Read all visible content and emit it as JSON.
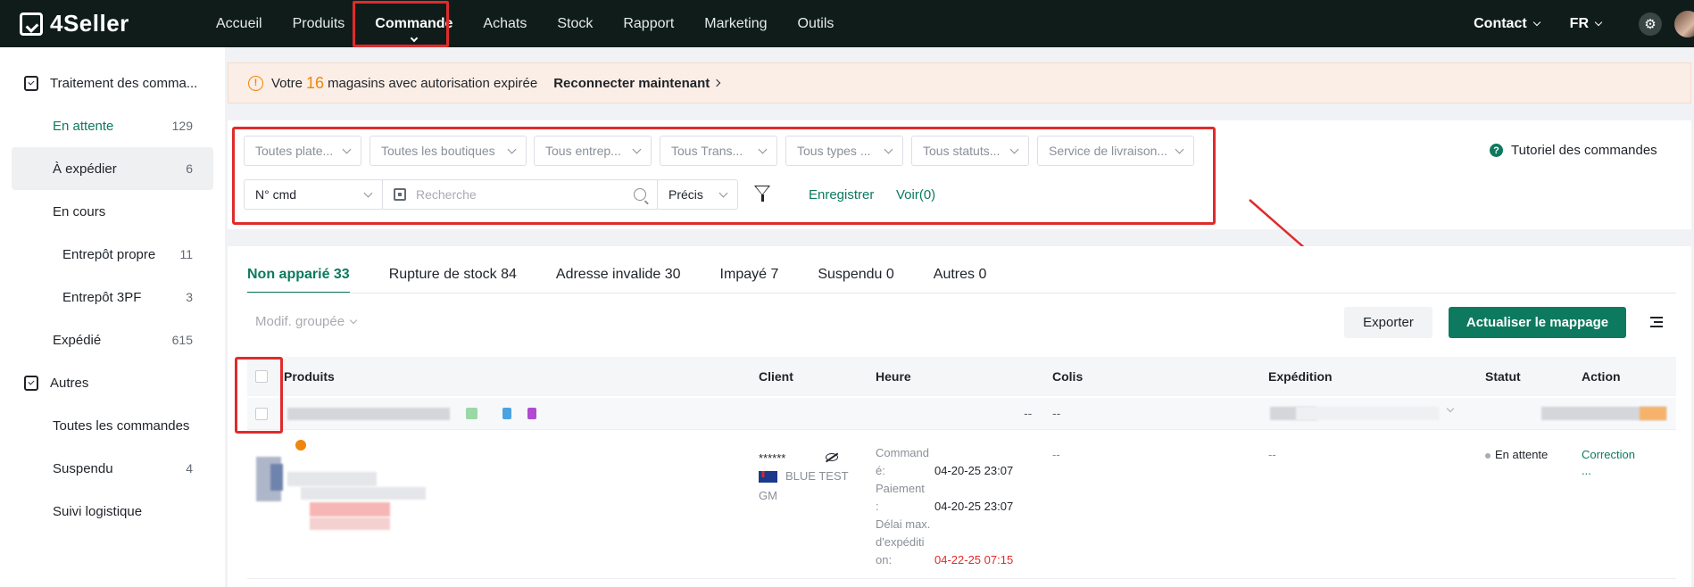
{
  "brand": {
    "name": "4Seller"
  },
  "nav": {
    "items": [
      "Accueil",
      "Produits",
      "Commande",
      "Achats",
      "Stock",
      "Rapport",
      "Marketing",
      "Outils"
    ],
    "active": "Commande",
    "contact": "Contact",
    "lang": "FR"
  },
  "sidebar": {
    "group1": "Traitement des comma...",
    "items": [
      {
        "label": "En attente",
        "count": "129"
      },
      {
        "label": "À expédier",
        "count": "6"
      },
      {
        "label": "En cours",
        "count": ""
      },
      {
        "label": "Entrepôt propre",
        "count": "11"
      },
      {
        "label": "Entrepôt 3PF",
        "count": "3"
      },
      {
        "label": "Expédié",
        "count": "615"
      }
    ],
    "group2": "Autres",
    "items2": [
      {
        "label": "Toutes les commandes",
        "count": ""
      },
      {
        "label": "Suspendu",
        "count": "4"
      },
      {
        "label": "Suivi logistique",
        "count": ""
      }
    ]
  },
  "alert": {
    "prefix": "Votre",
    "number": "16",
    "suffix": "magasins avec autorisation expirée",
    "link": "Reconnecter maintenant"
  },
  "filters": {
    "selects": [
      "Toutes plate...",
      "Toutes les boutiques",
      "Tous entrep...",
      "Tous Trans...",
      "Tous types ...",
      "Tous statuts...",
      "Service de livraison..."
    ],
    "order_field": "N° cmd",
    "search_placeholder": "Recherche",
    "match": "Précis",
    "save": "Enregistrer",
    "view": "Voir(0)",
    "tutorial": "Tutoriel des commandes"
  },
  "tabs": [
    "Non apparié 33",
    "Rupture de stock 84",
    "Adresse invalide 30",
    "Impayé 7",
    "Suspendu 0",
    "Autres 0"
  ],
  "toolbar": {
    "bulk": "Modif. groupée",
    "export": "Exporter",
    "update_mapping": "Actualiser le mappage"
  },
  "table": {
    "headers": [
      "Produits",
      "Client",
      "Heure",
      "Colis",
      "Expédition",
      "Statut",
      "Action"
    ],
    "group_row": {
      "dash1": "--",
      "dash2": "--"
    },
    "row": {
      "client_masked": "******",
      "client_name": "BLUE TEST",
      "client_suffix": "GM",
      "time_labels": [
        "Command\né:",
        "Paiement\n:",
        "Délai max.\nd'expéditi\non:"
      ],
      "time_values": [
        "04-20-25 23:07",
        "04-20-25 23:07",
        "04-22-25 07:15"
      ],
      "colis": "--",
      "expedition": "--",
      "status": "En attente",
      "action": "Correction",
      "action_more": "..."
    }
  },
  "colors": {
    "accent": "#0d7a5f",
    "annotation": "#e02b2b",
    "warning": "#f0860c"
  }
}
